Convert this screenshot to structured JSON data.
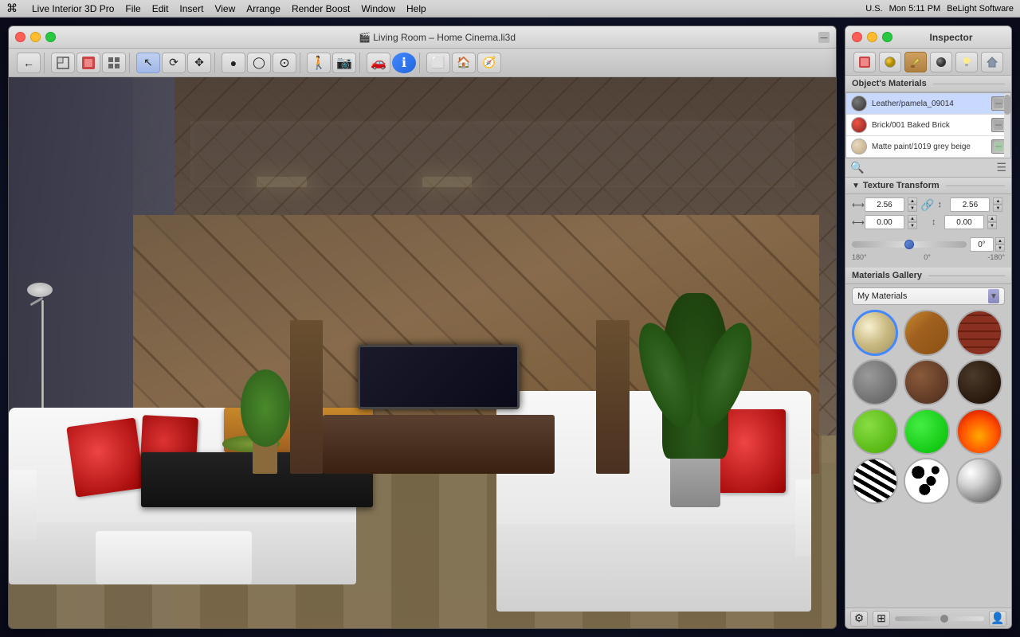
{
  "menubar": {
    "apple": "⌘",
    "app_name": "Live Interior 3D Pro",
    "menus": [
      "File",
      "Edit",
      "Insert",
      "View",
      "Arrange",
      "Render Boost",
      "Window",
      "Help"
    ],
    "right_info": "Mon 5:11 PM",
    "brand": "BeLight Software",
    "locale": "U.S."
  },
  "main_window": {
    "title": "🎬 Living Room – Home Cinema.li3d",
    "traffic_lights": {
      "close": "close",
      "minimize": "minimize",
      "maximize": "maximize"
    },
    "toolbar": {
      "buttons": [
        {
          "name": "back",
          "icon": "←"
        },
        {
          "name": "floor-plan",
          "icon": "▦"
        },
        {
          "name": "render",
          "icon": "⬛"
        },
        {
          "name": "tools",
          "icon": "☰"
        },
        {
          "name": "select",
          "icon": "↖"
        },
        {
          "name": "orbit",
          "icon": "⟳"
        },
        {
          "name": "pan",
          "icon": "✥"
        },
        {
          "name": "sphere",
          "icon": "●"
        },
        {
          "name": "cylinder",
          "icon": "⬤"
        },
        {
          "name": "torus",
          "icon": "○"
        },
        {
          "name": "walk",
          "icon": "🚶"
        },
        {
          "name": "camera",
          "icon": "📷"
        },
        {
          "name": "car",
          "icon": "🚗"
        },
        {
          "name": "info",
          "icon": "ℹ"
        },
        {
          "name": "frame",
          "icon": "⬜"
        },
        {
          "name": "house",
          "icon": "🏠"
        },
        {
          "name": "compass",
          "icon": "🧭"
        }
      ]
    }
  },
  "inspector": {
    "title": "Inspector",
    "tabs": [
      {
        "name": "materials-tab",
        "icon": "🔴",
        "active": false
      },
      {
        "name": "sphere-tab",
        "icon": "🟡",
        "active": false
      },
      {
        "name": "paint-tab",
        "icon": "✏️",
        "active": true
      },
      {
        "name": "texture-tab",
        "icon": "⬛",
        "active": false
      },
      {
        "name": "light-tab",
        "icon": "💡",
        "active": false
      },
      {
        "name": "house2-tab",
        "icon": "🏠",
        "active": false
      }
    ],
    "objects_materials": {
      "title": "Object's Materials",
      "items": [
        {
          "name": "Leather/pamela_09014",
          "swatch_color": "#555555",
          "swatch_type": "dark"
        },
        {
          "name": "Brick/001 Baked Brick",
          "swatch_color": "#bb3322",
          "swatch_type": "red"
        },
        {
          "name": "Matte paint/1019 grey beige",
          "swatch_color": "#d4c4aa",
          "swatch_type": "beige"
        }
      ]
    },
    "texture_transform": {
      "title": "Texture Transform",
      "scale_x": "2.56",
      "scale_y": "2.56",
      "offset_x": "0.00",
      "offset_y": "0.00",
      "rotation": "0°",
      "rotation_min": "180°",
      "rotation_zero": "0°",
      "rotation_max": "-180°"
    },
    "materials_gallery": {
      "title": "Materials Gallery",
      "dropdown_label": "My Materials",
      "items": [
        {
          "name": "ivory-sphere",
          "type": "ivory"
        },
        {
          "name": "wood1-sphere",
          "type": "wood1"
        },
        {
          "name": "brick-sphere",
          "type": "brick"
        },
        {
          "name": "concrete-sphere",
          "type": "concrete"
        },
        {
          "name": "brown-sphere",
          "type": "brown"
        },
        {
          "name": "dark-sphere",
          "type": "dark"
        },
        {
          "name": "green1-sphere",
          "type": "green1"
        },
        {
          "name": "green2-sphere",
          "type": "green2"
        },
        {
          "name": "fire-sphere",
          "type": "fire"
        },
        {
          "name": "zebra-sphere",
          "type": "zebra"
        },
        {
          "name": "spots-sphere",
          "type": "spots"
        },
        {
          "name": "chrome-sphere",
          "type": "chrome"
        }
      ]
    },
    "bottom_toolbar": {
      "gear_icon": "⚙",
      "grid_icon": "⊞",
      "person_icon": "👤"
    }
  }
}
